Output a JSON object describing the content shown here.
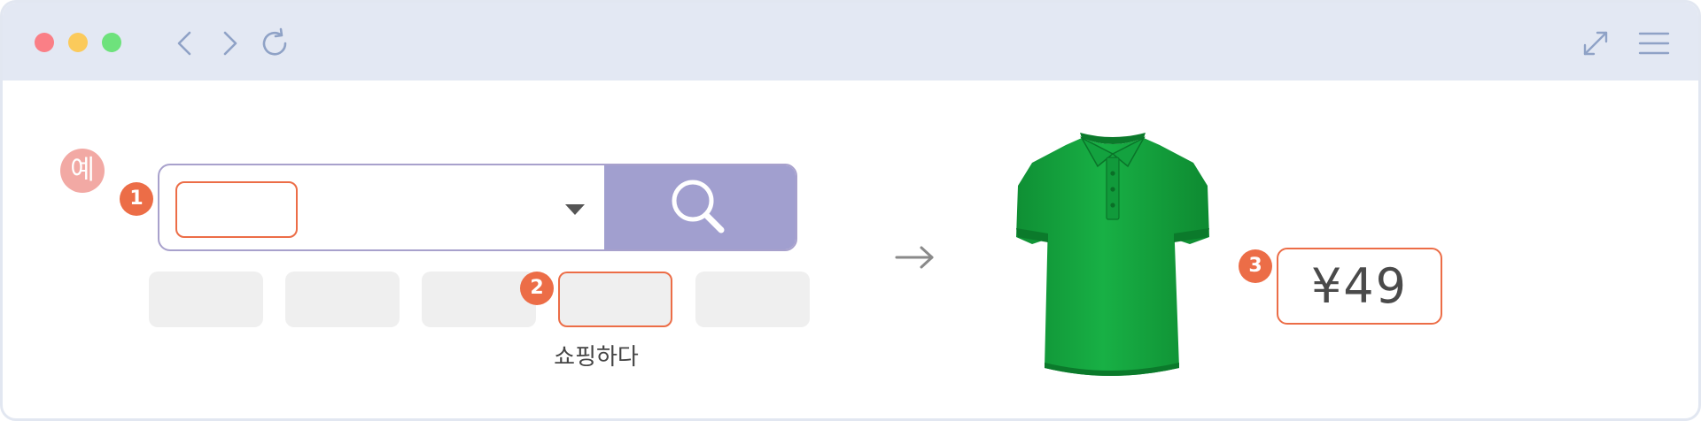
{
  "browser": {
    "window_controls": [
      "close",
      "minimize",
      "maximize"
    ],
    "nav_icons": [
      "back-icon",
      "forward-icon",
      "reload-icon"
    ],
    "right_icons": [
      "expand-icon",
      "menu-icon"
    ]
  },
  "example_badge": "예",
  "steps": [
    "1",
    "2",
    "3"
  ],
  "search": {
    "input_value": "",
    "button_icon": "search-icon"
  },
  "categories": {
    "count": 5,
    "active_label": "쇼핑하다"
  },
  "product": {
    "image": "green-polo-shirt",
    "price": "¥49"
  },
  "colors": {
    "accent": "#ec6d47",
    "search_button": "#a19fcf",
    "shirt": "#14a83e"
  }
}
